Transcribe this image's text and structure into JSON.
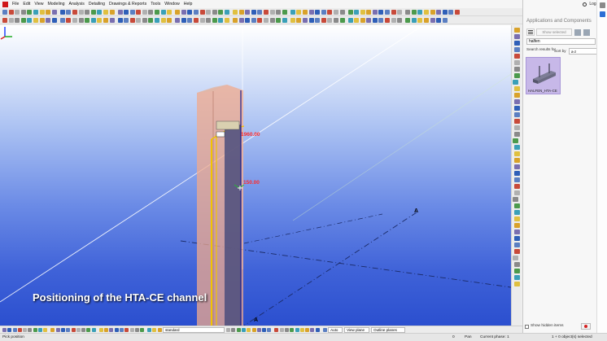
{
  "menu": {
    "items": [
      "File",
      "Edit",
      "View",
      "Modeling",
      "Analysis",
      "Detailing",
      "Drawings & Reports",
      "Tools",
      "Window",
      "Help"
    ]
  },
  "viewport": {
    "caption": "Positioning of the HTA-CE channel",
    "dimension_labels": [
      "1960.00",
      "150.00"
    ],
    "gridline_labels": [
      "A",
      "A"
    ]
  },
  "bottom_toolbar": {
    "settings_value": "standard",
    "snap_mode": "Auto",
    "plane": "View plane",
    "snap_scope": "Outline planes"
  },
  "panel": {
    "login": "Log in",
    "title": "Applications and Components",
    "show_selected": "Show selected",
    "search_value": "halfen",
    "results_label": "Search results for",
    "sort_label": "Sort by",
    "sort_value": "a-z",
    "component_name": "HALFEN_HTA-CE",
    "show_hidden_label": "Show hidden items"
  },
  "status": {
    "message": "Pick position",
    "value": "0",
    "mode": "Pan",
    "phase": "Current phase: 1",
    "selection": "1 + 0 object(s) selected"
  },
  "colors": {
    "viewport_top": "#ffffff",
    "viewport_bottom": "#2b4fcf",
    "column_fill": "#f0a98c",
    "channel_outline": "#f2c400",
    "dimension_text": "#ff2a2a",
    "component_tile": "#c7b8e8"
  }
}
